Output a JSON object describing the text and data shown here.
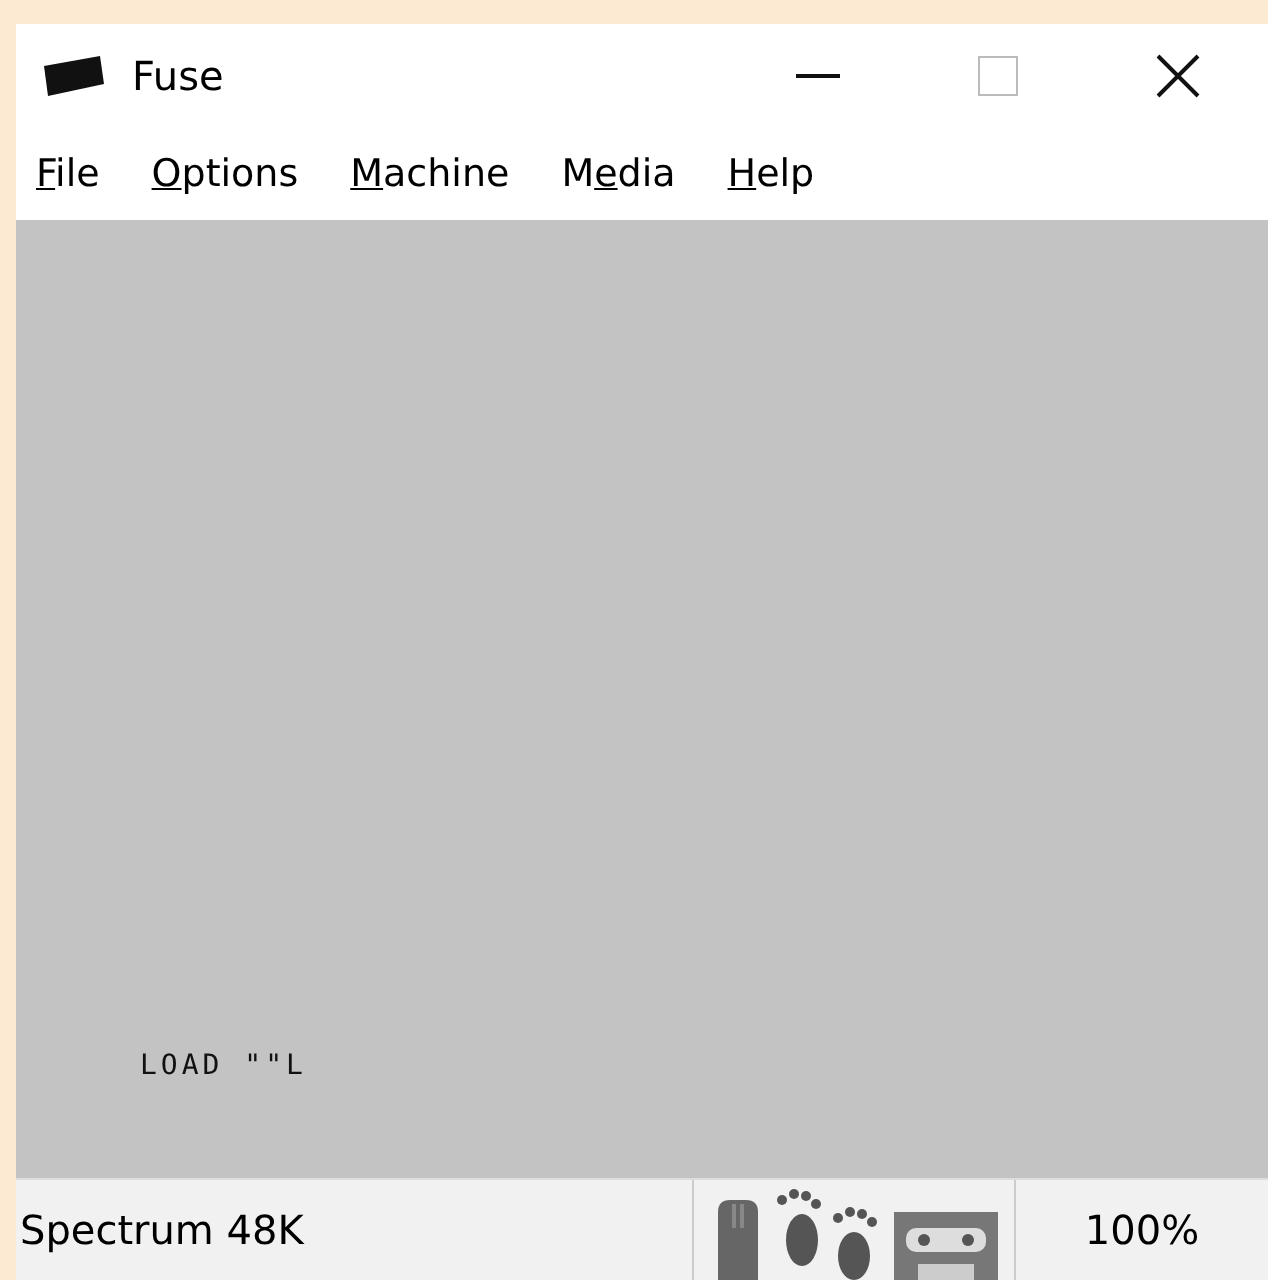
{
  "window": {
    "title": "Fuse"
  },
  "menu": [
    {
      "key": "F",
      "after": "ile"
    },
    {
      "key": "O",
      "after": "ptions"
    },
    {
      "key": "M",
      "after": "achine"
    },
    {
      "before": "M",
      "key": "e",
      "after": "dia"
    },
    {
      "key": "H",
      "after": "elp"
    }
  ],
  "screen": {
    "text": "LOAD \"\"L"
  },
  "status_bar": {
    "machine": "Spectrum 48K",
    "speed": "100%"
  }
}
